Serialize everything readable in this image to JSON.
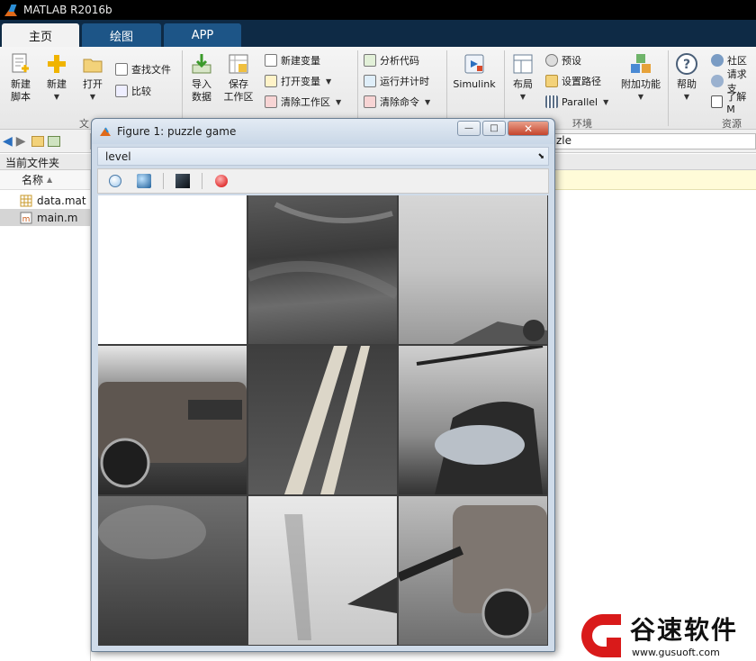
{
  "app": {
    "title": "MATLAB R2016b"
  },
  "tabs": [
    {
      "label": "主页",
      "active": true
    },
    {
      "label": "绘图"
    },
    {
      "label": "APP"
    }
  ],
  "ribbon": {
    "file": {
      "new_script": "新建\n脚本",
      "new": "新建",
      "open": "打开",
      "find_files": "查找文件",
      "compare": "比较",
      "group_label": "文"
    },
    "variable": {
      "import": "导入\n数据",
      "save_ws": "保存\n工作区",
      "new_var": "新建变量",
      "open_var": "打开变量",
      "clear_ws": "清除工作区"
    },
    "code": {
      "analyze": "分析代码",
      "run_time": "运行并计时",
      "clear_cmd": "清除命令"
    },
    "simulink": {
      "label": "Simulink"
    },
    "env": {
      "layout": "布局",
      "prefs": "预设",
      "set_path": "设置路径",
      "parallel": "Parallel",
      "addons": "附加功能",
      "group_label": "环境"
    },
    "resources": {
      "help": "帮助",
      "community": "社区",
      "request_support": "请求支",
      "learn": "了解 M",
      "group_label": "资源"
    }
  },
  "address": {
    "tail": "zle"
  },
  "current_folder": {
    "title": "当前文件夹",
    "column": "名称",
    "files": [
      {
        "name": "data.mat",
        "selected": false
      },
      {
        "name": "main.m",
        "selected": true
      }
    ]
  },
  "figure": {
    "title": "Figure 1: puzzle game",
    "menu_item": "level",
    "toolbar_icons": [
      "circle-icon",
      "sphere-icon",
      "dark-image-icon",
      "record-icon"
    ]
  },
  "puzzle": {
    "grid": "3x3",
    "empty_tile": 0
  },
  "watermark": {
    "text": "谷速软件",
    "url": "www.gusuoft.com"
  }
}
